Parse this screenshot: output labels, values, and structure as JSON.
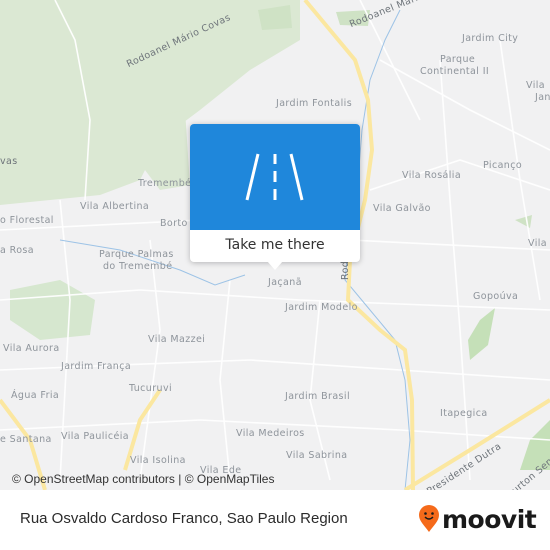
{
  "map": {
    "labels": [
      {
        "text": "Rodoanel Mário Covas",
        "kind": "road"
      },
      {
        "text": "Rodoanel Mário Covas",
        "kind": "road"
      },
      {
        "text": "Jardim City",
        "kind": "place"
      },
      {
        "text": "Parque",
        "kind": "place"
      },
      {
        "text": "Continental II",
        "kind": "place"
      },
      {
        "text": "Vila",
        "kind": "place"
      },
      {
        "text": "Jan",
        "kind": "place"
      },
      {
        "text": "Jardim Fontalis",
        "kind": "place"
      },
      {
        "text": "vas",
        "kind": "road"
      },
      {
        "text": "Tremembé",
        "kind": "place"
      },
      {
        "text": "Picanço",
        "kind": "place"
      },
      {
        "text": "Vila Rosália",
        "kind": "place"
      },
      {
        "text": "o Florestal",
        "kind": "place"
      },
      {
        "text": "Vila Albertina",
        "kind": "place"
      },
      {
        "text": "Borto",
        "kind": "place"
      },
      {
        "text": "Vila Galvão",
        "kind": "place"
      },
      {
        "text": "Vila",
        "kind": "place"
      },
      {
        "text": "a Rosa",
        "kind": "place"
      },
      {
        "text": "Parque Palmas",
        "kind": "place"
      },
      {
        "text": "do Tremembé",
        "kind": "place"
      },
      {
        "text": "Jaçanã",
        "kind": "place"
      },
      {
        "text": "Rod",
        "kind": "road"
      },
      {
        "text": "Gopoúva",
        "kind": "place"
      },
      {
        "text": "Jardim Modelo",
        "kind": "place"
      },
      {
        "text": "Vila Mazzei",
        "kind": "place"
      },
      {
        "text": "Vila Aurora",
        "kind": "place"
      },
      {
        "text": "Jardim França",
        "kind": "place"
      },
      {
        "text": "Tucuruvi",
        "kind": "place"
      },
      {
        "text": "Água Fria",
        "kind": "place"
      },
      {
        "text": "Jardim Brasil",
        "kind": "place"
      },
      {
        "text": "Itapegica",
        "kind": "place"
      },
      {
        "text": "e Santana",
        "kind": "place"
      },
      {
        "text": "Vila Paulicéia",
        "kind": "place"
      },
      {
        "text": "Vila Medeiros",
        "kind": "place"
      },
      {
        "text": "Vila Sabrina",
        "kind": "place"
      },
      {
        "text": "Vila Isolina",
        "kind": "place"
      },
      {
        "text": "Vila Ede",
        "kind": "place"
      },
      {
        "text": "Presidente Dutra",
        "kind": "road"
      },
      {
        "text": "urton Senn",
        "kind": "road"
      }
    ],
    "attribution": "© OpenStreetMap contributors | © OpenMapTiles"
  },
  "popup": {
    "icon": "road-icon",
    "button_label": "Take me there",
    "accent_color": "#1f87db"
  },
  "footer": {
    "title": "Rua Osvaldo Cardoso Franco, Sao Paulo Region",
    "logo_text": "moovit",
    "logo_color": "#f56a1a"
  }
}
